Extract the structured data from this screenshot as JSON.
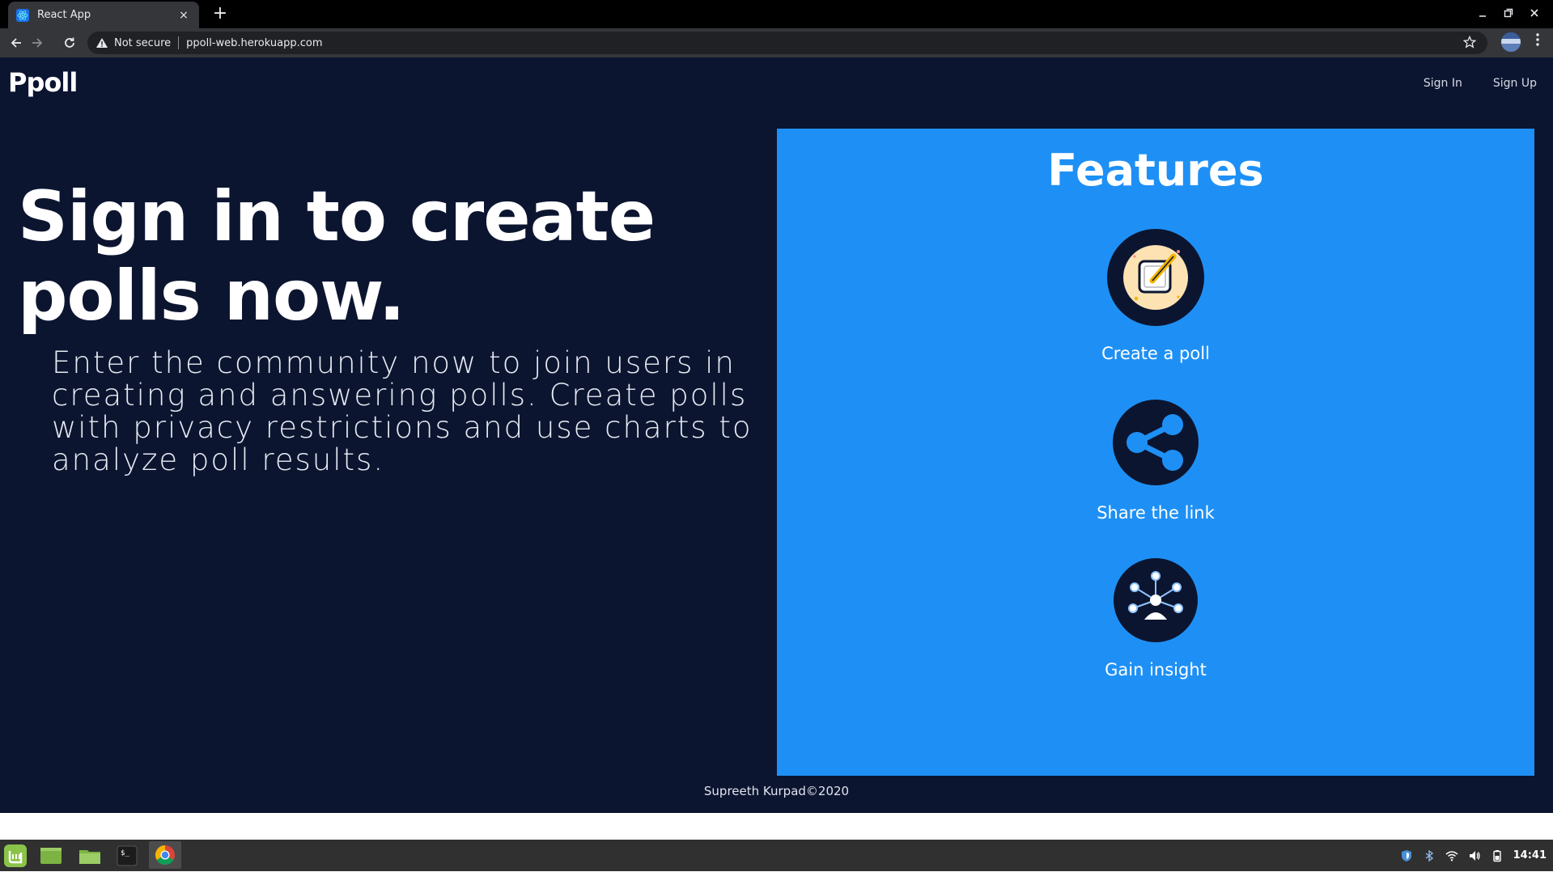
{
  "browser": {
    "tab_title": "React App",
    "new_tab_label": "+",
    "close_tab_label": "×",
    "not_secure_label": "Not secure",
    "url": "ppoll-web.herokuapp.com"
  },
  "header": {
    "logo": "Ppoll",
    "sign_in": "Sign In",
    "sign_up": "Sign Up"
  },
  "hero": {
    "headline": "Sign in to create polls now.",
    "description": "Enter the community now to join users in creating and answering polls. Create polls with privacy restrictions and use charts to analyze poll results."
  },
  "features": {
    "title": "Features",
    "items": [
      {
        "label": "Create a poll",
        "icon": "pencil-note-icon"
      },
      {
        "label": "Share the link",
        "icon": "share-icon"
      },
      {
        "label": "Gain insight",
        "icon": "network-person-icon"
      }
    ]
  },
  "footer": {
    "text": "Supreeth Kurpad©2020"
  },
  "taskbar": {
    "clock": "14:41"
  },
  "colors": {
    "page_background": "#0c1530",
    "features_background": "#1e90f5",
    "browser_toolbar": "#35363a"
  }
}
